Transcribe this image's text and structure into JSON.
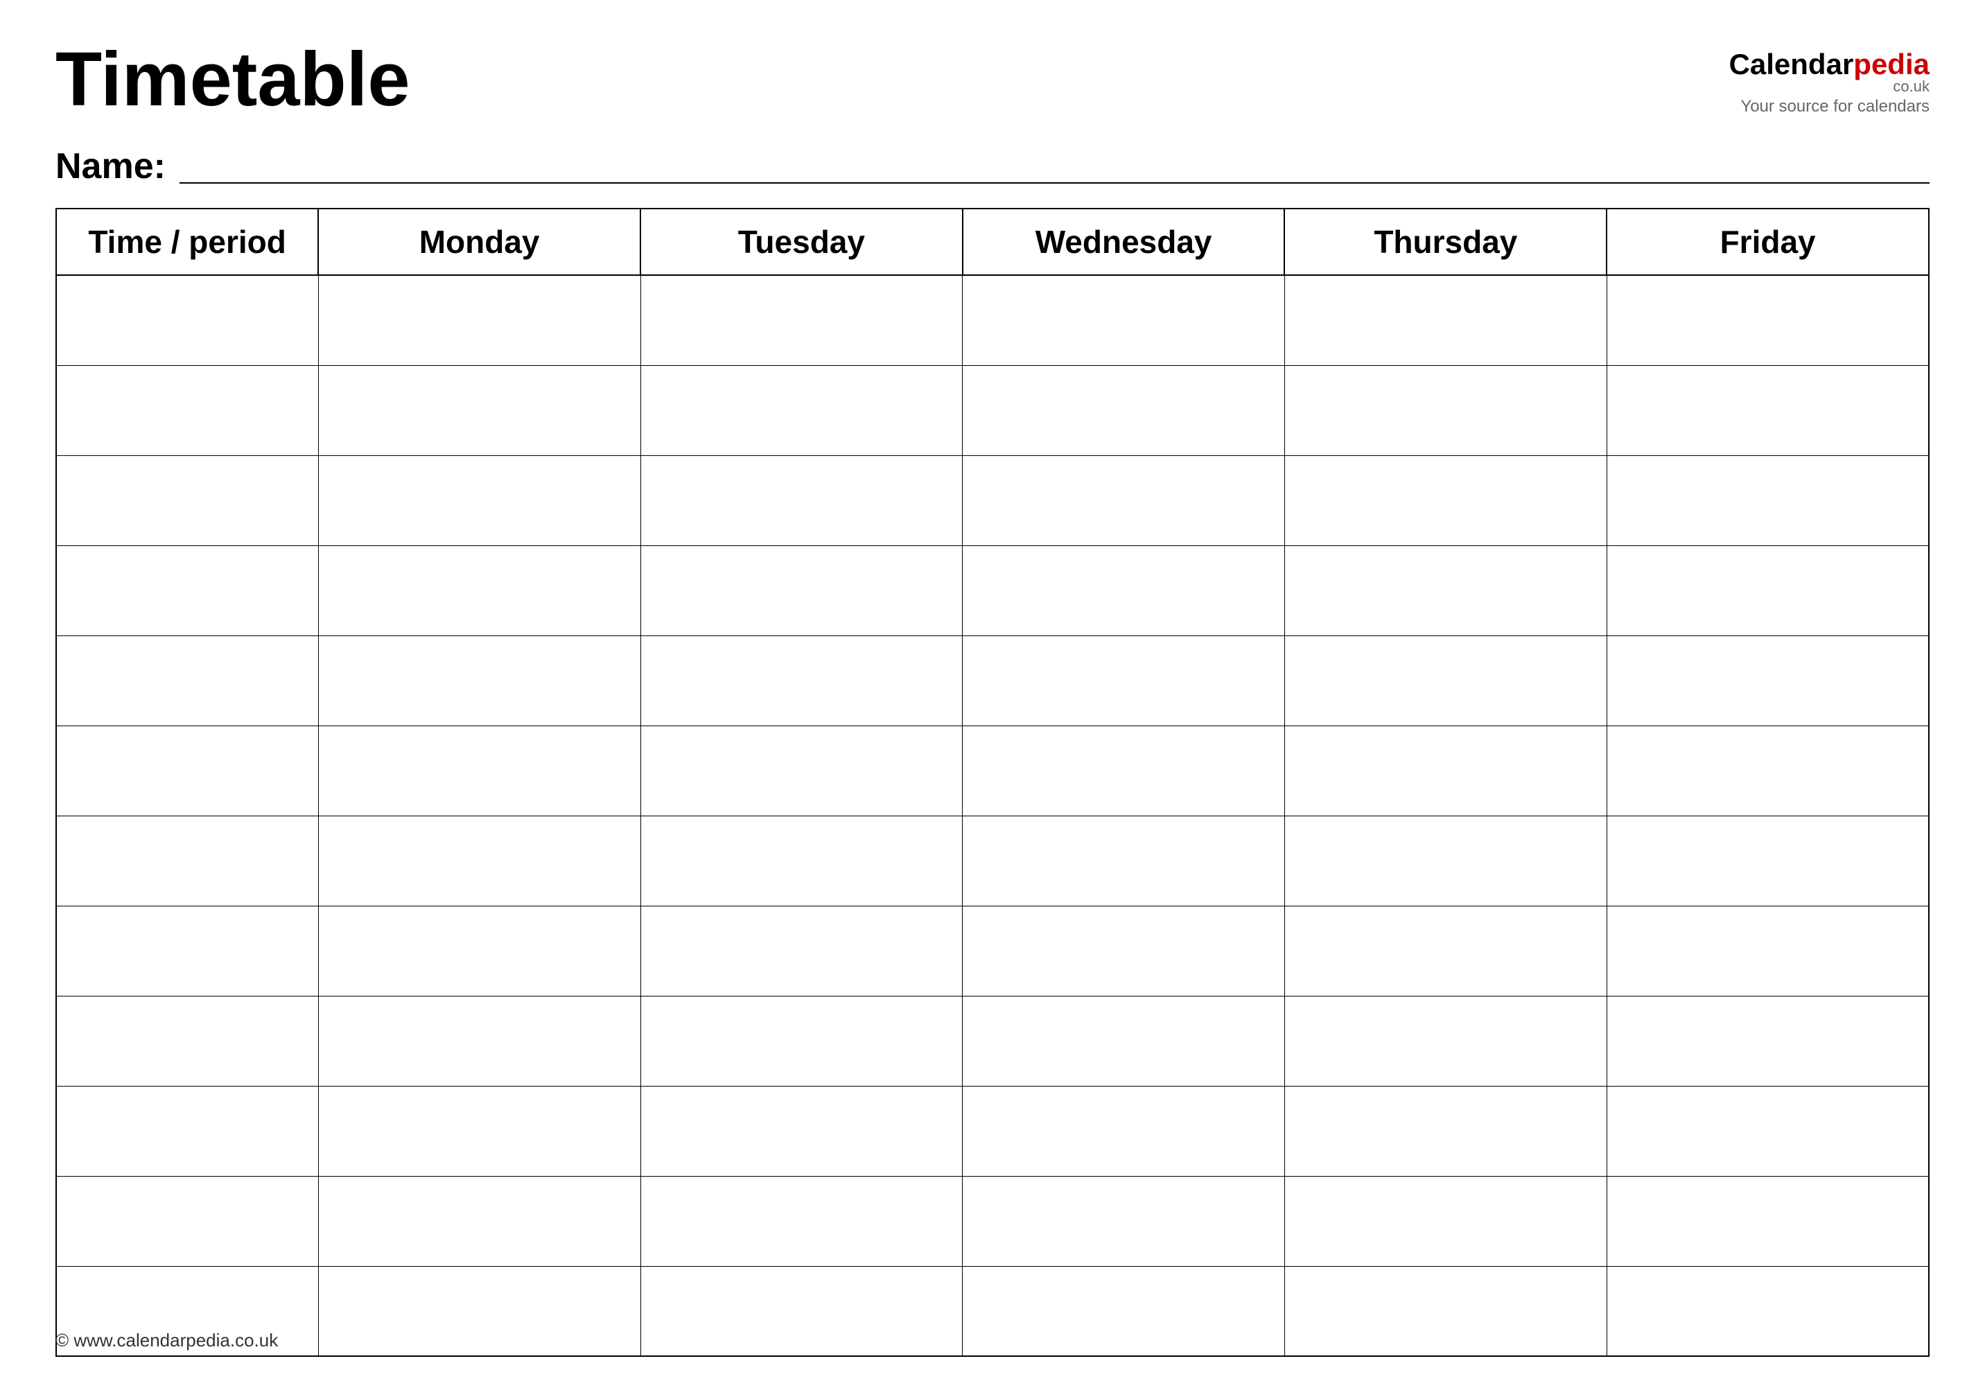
{
  "header": {
    "title": "Timetable",
    "logo": {
      "calendar_text": "Calendar",
      "pedia_text": "pedia",
      "couk": "co.uk",
      "tagline": "Your source for calendars"
    }
  },
  "name_section": {
    "label": "Name:"
  },
  "table": {
    "columns": [
      {
        "id": "time",
        "label": "Time / period"
      },
      {
        "id": "mon",
        "label": "Monday"
      },
      {
        "id": "tue",
        "label": "Tuesday"
      },
      {
        "id": "wed",
        "label": "Wednesday"
      },
      {
        "id": "thu",
        "label": "Thursday"
      },
      {
        "id": "fri",
        "label": "Friday"
      }
    ],
    "row_count": 12
  },
  "footer": {
    "text": "© www.calendarpedia.co.uk"
  }
}
